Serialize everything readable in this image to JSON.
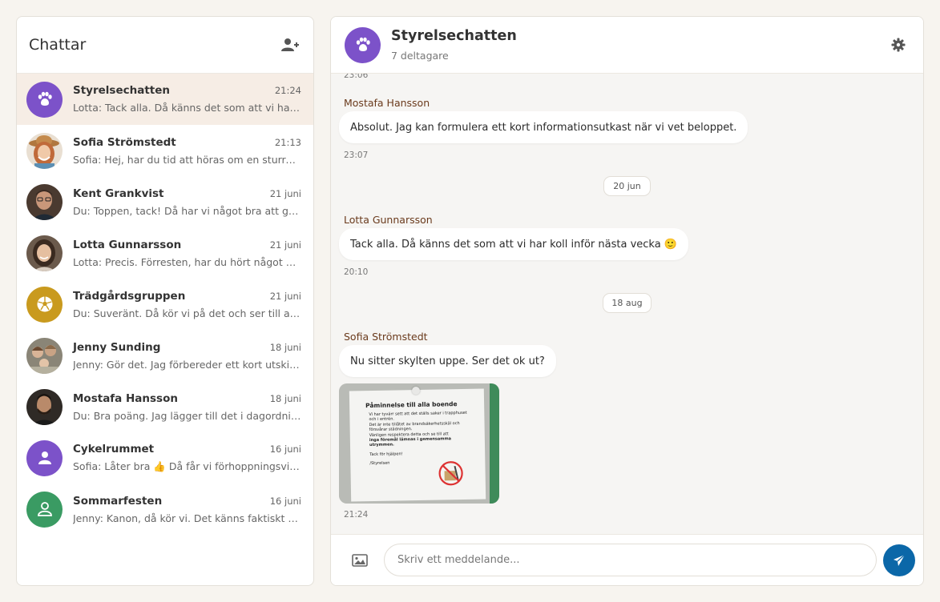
{
  "colors": {
    "background": "#f7f4ef",
    "active_item": "#f6ede5",
    "purple": "#7c52c9",
    "gold": "#c99a1e",
    "green": "#3a9b63",
    "send": "#0b67a8",
    "sender_name": "#6a3a1c"
  },
  "sidebar": {
    "title": "Chattar",
    "add_icon": "add-user-icon",
    "chats": [
      {
        "name": "Styrelsechatten",
        "time": "21:24",
        "preview": "Lotta: Tack alla. Då känns det som att vi har koll inför nästa vecka 🙂",
        "avatar": "paw-icon",
        "avatar_color": "#7c52c9",
        "active": true
      },
      {
        "name": "Sofia Strömstedt",
        "time": "21:13",
        "preview": "Sofia: Hej, har du tid att höras om en sturre sak?",
        "avatar": "photo"
      },
      {
        "name": "Kent Grankvist",
        "time": "21 juni",
        "preview": "Du: Toppen, tack! Då har vi något bra att gå på.",
        "avatar": "photo"
      },
      {
        "name": "Lotta Gunnarsson",
        "time": "21 juni",
        "preview": "Lotta: Precis. Förresten, har du hört något om det?",
        "avatar": "photo"
      },
      {
        "name": "Trädgårdsgruppen",
        "time": "21 juni",
        "preview": "Du: Suveränt. Då kör vi på det och ser till att alla vet.",
        "avatar": "ball-icon",
        "avatar_color": "#c99a1e"
      },
      {
        "name": "Jenny Sunding",
        "time": "18 juni",
        "preview": "Jenny: Gör det. Jag förbereder ett kort utskick.",
        "avatar": "photo"
      },
      {
        "name": "Mostafa Hansson",
        "time": "18 juni",
        "preview": "Du: Bra poäng. Jag lägger till det i dagordningen.",
        "avatar": "photo"
      },
      {
        "name": "Cykelrummet",
        "time": "16 juni",
        "preview": "Sofia: Låter bra 👍 Då får vi förhoppningsvis ordning.",
        "avatar": "user-icon",
        "avatar_color": "#7c52c9"
      },
      {
        "name": "Sommarfesten",
        "time": "16 juni",
        "preview": "Jenny: Kanon, då kör vi. Det känns faktiskt roligt!",
        "avatar": "user-outline-icon",
        "avatar_color": "#3a9b63"
      }
    ]
  },
  "header": {
    "title": "Styrelsechatten",
    "subtitle": "7 deltagare",
    "avatar_icon": "paw-icon",
    "settings_icon": "gear-icon"
  },
  "messages": {
    "top_partial_time": "23:06",
    "items": [
      {
        "sender": "Mostafa Hansson",
        "text": "Absolut. Jag kan formulera ett kort informationsutkast när vi vet beloppet.",
        "time": "23:07"
      },
      {
        "date": "20 jun"
      },
      {
        "sender": "Lotta Gunnarsson",
        "text": "Tack alla. Då känns det som att vi har koll inför nästa vecka 🙂",
        "time": "20:10"
      },
      {
        "date": "18 aug"
      },
      {
        "sender": "Sofia Strömstedt",
        "text": "Nu sitter skylten uppe. Ser det ok ut?",
        "time": "21:24"
      }
    ],
    "photo_sign": {
      "title": "Påminnelse till alla boende",
      "line1": "Vi har tyvärr sett att det ställs saker i trapphuset",
      "line2": "och i entrén.",
      "line3": "Det är inte tillåtet av brandsäkerhetsskäl och",
      "line4": "försvårar städningen.",
      "line5": "Vänligen respektera detta och se till att",
      "line6": "inga föremål lämnas i gemensamma",
      "line7": "utrymmen.",
      "thanks": "Tack för hjälpen!",
      "signature": "/Styrelsen"
    }
  },
  "composer": {
    "placeholder": "Skriv ett meddelande...",
    "image_icon": "image-icon",
    "send_icon": "send-icon"
  }
}
